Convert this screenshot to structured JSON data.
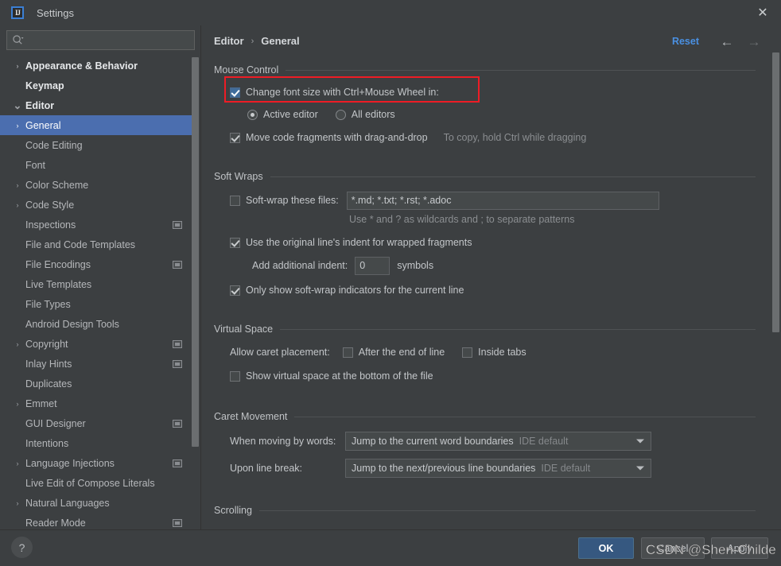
{
  "window": {
    "title": "Settings",
    "logo_text": "IJ",
    "close_label": "✕"
  },
  "sidebar": {
    "search_placeholder": "",
    "search_value": "",
    "items": [
      {
        "label": "Appearance & Behavior",
        "level": 0,
        "chevron": "›",
        "expanded": false,
        "selected": false,
        "badge": false
      },
      {
        "label": "Keymap",
        "level": 0,
        "chevron": "",
        "expanded": false,
        "selected": false,
        "badge": false
      },
      {
        "label": "Editor",
        "level": 0,
        "chevron": "⌄",
        "expanded": true,
        "selected": false,
        "badge": false
      },
      {
        "label": "General",
        "level": 1,
        "chevron": "›",
        "expanded": false,
        "selected": true,
        "badge": false
      },
      {
        "label": "Code Editing",
        "level": 1,
        "chevron": "",
        "expanded": false,
        "selected": false,
        "badge": false
      },
      {
        "label": "Font",
        "level": 1,
        "chevron": "",
        "expanded": false,
        "selected": false,
        "badge": false
      },
      {
        "label": "Color Scheme",
        "level": 1,
        "chevron": "›",
        "expanded": false,
        "selected": false,
        "badge": false
      },
      {
        "label": "Code Style",
        "level": 1,
        "chevron": "›",
        "expanded": false,
        "selected": false,
        "badge": false
      },
      {
        "label": "Inspections",
        "level": 1,
        "chevron": "",
        "expanded": false,
        "selected": false,
        "badge": true
      },
      {
        "label": "File and Code Templates",
        "level": 1,
        "chevron": "",
        "expanded": false,
        "selected": false,
        "badge": false
      },
      {
        "label": "File Encodings",
        "level": 1,
        "chevron": "",
        "expanded": false,
        "selected": false,
        "badge": true
      },
      {
        "label": "Live Templates",
        "level": 1,
        "chevron": "",
        "expanded": false,
        "selected": false,
        "badge": false
      },
      {
        "label": "File Types",
        "level": 1,
        "chevron": "",
        "expanded": false,
        "selected": false,
        "badge": false
      },
      {
        "label": "Android Design Tools",
        "level": 1,
        "chevron": "",
        "expanded": false,
        "selected": false,
        "badge": false
      },
      {
        "label": "Copyright",
        "level": 1,
        "chevron": "›",
        "expanded": false,
        "selected": false,
        "badge": true
      },
      {
        "label": "Inlay Hints",
        "level": 1,
        "chevron": "",
        "expanded": false,
        "selected": false,
        "badge": true
      },
      {
        "label": "Duplicates",
        "level": 1,
        "chevron": "",
        "expanded": false,
        "selected": false,
        "badge": false
      },
      {
        "label": "Emmet",
        "level": 1,
        "chevron": "›",
        "expanded": false,
        "selected": false,
        "badge": false
      },
      {
        "label": "GUI Designer",
        "level": 1,
        "chevron": "",
        "expanded": false,
        "selected": false,
        "badge": true
      },
      {
        "label": "Intentions",
        "level": 1,
        "chevron": "",
        "expanded": false,
        "selected": false,
        "badge": false
      },
      {
        "label": "Language Injections",
        "level": 1,
        "chevron": "›",
        "expanded": false,
        "selected": false,
        "badge": true
      },
      {
        "label": "Live Edit of Compose Literals",
        "level": 1,
        "chevron": "",
        "expanded": false,
        "selected": false,
        "badge": false
      },
      {
        "label": "Natural Languages",
        "level": 1,
        "chevron": "›",
        "expanded": false,
        "selected": false,
        "badge": false
      },
      {
        "label": "Reader Mode",
        "level": 1,
        "chevron": "",
        "expanded": false,
        "selected": false,
        "badge": true
      }
    ]
  },
  "header": {
    "breadcrumb_parent": "Editor",
    "breadcrumb_sep": "›",
    "breadcrumb_current": "General",
    "reset_label": "Reset",
    "back_icon": "←",
    "forward_icon": "→"
  },
  "sections": {
    "mouse_control": {
      "title": "Mouse Control",
      "change_font_size_label": "Change font size with Ctrl+Mouse Wheel in:",
      "change_font_size_checked": true,
      "radio_active_editor": "Active editor",
      "radio_all_editors": "All editors",
      "radio_selected": "Active editor",
      "move_fragments_label": "Move code fragments with drag-and-drop",
      "move_fragments_checked": true,
      "move_fragments_hint": "To copy, hold Ctrl while dragging"
    },
    "soft_wraps": {
      "title": "Soft Wraps",
      "soft_wrap_files_label": "Soft-wrap these files:",
      "soft_wrap_files_checked": false,
      "soft_wrap_files_value": "*.md; *.txt; *.rst; *.adoc",
      "wildcard_hint": "Use * and ? as wildcards and ; to separate patterns",
      "original_indent_label": "Use the original line's indent for wrapped fragments",
      "original_indent_checked": true,
      "additional_indent_label": "Add additional indent:",
      "additional_indent_value": "0",
      "additional_indent_suffix": "symbols",
      "only_show_indicators_label": "Only show soft-wrap indicators for the current line",
      "only_show_indicators_checked": true
    },
    "virtual_space": {
      "title": "Virtual Space",
      "allow_caret_label": "Allow caret placement:",
      "after_end_of_line_label": "After the end of line",
      "after_end_of_line_checked": false,
      "inside_tabs_label": "Inside tabs",
      "inside_tabs_checked": false,
      "show_virtual_space_label": "Show virtual space at the bottom of the file",
      "show_virtual_space_checked": false
    },
    "caret_movement": {
      "title": "Caret Movement",
      "when_moving_label": "When moving by words:",
      "when_moving_value": "Jump to the current word boundaries",
      "when_moving_default": "IDE default",
      "upon_line_break_label": "Upon line break:",
      "upon_line_break_value": "Jump to the next/previous line boundaries",
      "upon_line_break_default": "IDE default"
    },
    "scrolling": {
      "title": "Scrolling"
    }
  },
  "footer": {
    "help_label": "?",
    "ok_label": "OK",
    "cancel_label": "Cancel",
    "apply_label": "Apply"
  },
  "watermark": {
    "text": "CSDN @Shen-Childe"
  },
  "colors": {
    "background": "#3c3f41",
    "selection": "#4b6eaf",
    "accent_blue": "#4a90e2",
    "ok_button": "#365880",
    "highlight_red": "#ee1c25"
  }
}
